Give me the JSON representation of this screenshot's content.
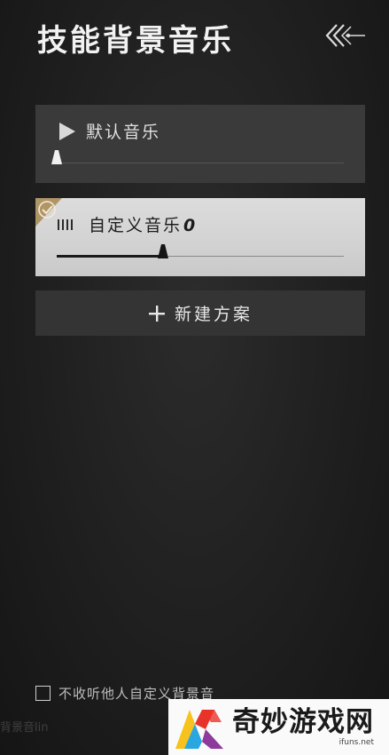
{
  "header": {
    "title": "技能背景音乐",
    "back_icon": "chevron-double-left-icon"
  },
  "tracks": [
    {
      "label": "默认音乐",
      "icon": "play-icon",
      "volume": 0.0,
      "selected": false
    },
    {
      "label": "自定义音乐",
      "number": "0",
      "icon": "list-icon",
      "volume": 0.37,
      "selected": true
    }
  ],
  "new_plan_button": {
    "label": "新建方案",
    "icon": "plus-icon"
  },
  "footer": {
    "checkbox_label": "不收听他人自定义背景音",
    "checked": false,
    "ghost_text": "背景音lin"
  },
  "watermark": {
    "name": "奇妙游戏网",
    "domain": "ifuns.net"
  },
  "colors": {
    "background": "#1f1f1f",
    "card_dark": "#3a3a3a",
    "card_light": "#d6d6d6",
    "accent_gold": "#a88a52"
  }
}
